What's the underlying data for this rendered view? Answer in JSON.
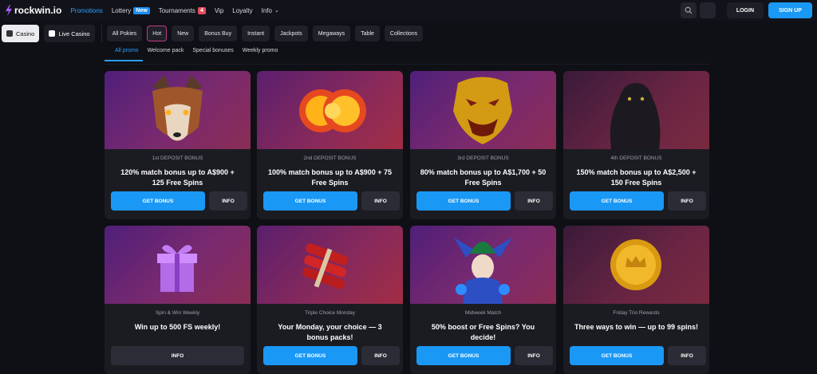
{
  "brand": "rockwin.io",
  "nav": [
    {
      "label": "Promotions",
      "active": true
    },
    {
      "label": "Lottery",
      "badge": "New"
    },
    {
      "label": "Tournaments",
      "badge": "4"
    },
    {
      "label": "Vip"
    },
    {
      "label": "Loyalty"
    },
    {
      "label": "Info"
    }
  ],
  "auth": {
    "login": "LOGIN",
    "signup": "SIGN UP"
  },
  "categories": {
    "casino": "Casino",
    "live": "Live Casino"
  },
  "chips": [
    "All Pokies",
    "Hot",
    "New",
    "Bonus Buy",
    "Instant",
    "Jackpots",
    "Megaways",
    "Table",
    "Collections"
  ],
  "tabs": [
    "All promo",
    "Welcome pack",
    "Special bonuses",
    "Weekly promo"
  ],
  "cards": [
    {
      "subtitle": "1st DEPOSIT BONUS",
      "title": "120% match bonus up to A$900 + 125 Free Spins",
      "get": "GET BONUS",
      "info": "INFO",
      "art": "wolf"
    },
    {
      "subtitle": "2nd DEPOSIT BONUS",
      "title": "100% match bonus up to A$900 + 75 Free Spins",
      "get": "GET BONUS",
      "info": "INFO",
      "art": "coins"
    },
    {
      "subtitle": "3rd DEPOSIT BONUS",
      "title": "80% match bonus up to A$1,700 + 50 Free Spins",
      "get": "GET BONUS",
      "info": "INFO",
      "art": "dragon"
    },
    {
      "subtitle": "4th DEPOSIT BONUS",
      "title": "150% match bonus up to A$2,500 + 150 Free Spins",
      "get": "GET BONUS",
      "info": "INFO",
      "art": "panther"
    },
    {
      "subtitle": "Spin & Win Weekly",
      "title": "Win up to 500 FS weekly!",
      "info": "INFO",
      "art": "giftbox"
    },
    {
      "subtitle": "Triple Choice Monday",
      "title": "Your Monday, your choice — 3 bonus packs!",
      "get": "GET BONUS",
      "info": "INFO",
      "art": "dynamite"
    },
    {
      "subtitle": "Midweek Match",
      "title": "50% boost or Free Spins? You decide!",
      "get": "GET BONUS",
      "info": "INFO",
      "art": "jester"
    },
    {
      "subtitle": "Friday Trio Rewards",
      "title": "Three ways to win — up to 99 spins!",
      "get": "GET BONUS",
      "info": "INFO",
      "art": "gold-coin"
    }
  ]
}
